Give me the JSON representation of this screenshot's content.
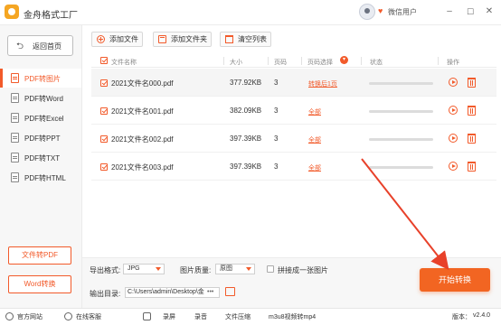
{
  "app": {
    "title": "金舟格式工厂",
    "username": "微信用户",
    "window_buttons": [
      "minimize-icon",
      "maximize-icon",
      "close-icon"
    ]
  },
  "sidebar": {
    "home_label": "返回首页",
    "items": [
      {
        "label": "PDF转图片",
        "active": true
      },
      {
        "label": "PDF转Word",
        "active": false
      },
      {
        "label": "PDF转Excel",
        "active": false
      },
      {
        "label": "PDF转PPT",
        "active": false
      },
      {
        "label": "PDF转TXT",
        "active": false
      },
      {
        "label": "PDF转HTML",
        "active": false
      }
    ],
    "bottom_buttons": [
      "文件转PDF",
      "Word转换"
    ]
  },
  "toolbar": {
    "add_file": "添加文件",
    "add_folder": "添加文件夹",
    "clear_list": "清空列表"
  },
  "table": {
    "headers": {
      "name": "文件名称",
      "size": "大小",
      "pages": "页码",
      "page_select": "页码选择",
      "status": "状态",
      "actions": "操作"
    },
    "rows": [
      {
        "name": "2021文件名000.pdf",
        "size": "377.92KB",
        "pages": "3",
        "page_select": "转换后1页",
        "progress": 0,
        "highlighted": true
      },
      {
        "name": "2021文件名001.pdf",
        "size": "382.09KB",
        "pages": "3",
        "page_select": "全部",
        "progress": 0,
        "highlighted": false
      },
      {
        "name": "2021文件名002.pdf",
        "size": "397.39KB",
        "pages": "3",
        "page_select": "全部",
        "progress": 0,
        "highlighted": false
      },
      {
        "name": "2021文件名003.pdf",
        "size": "397.39KB",
        "pages": "3",
        "page_select": "全部",
        "progress": 0,
        "highlighted": false
      }
    ]
  },
  "options": {
    "format_label": "导出格式:",
    "format_value": "JPG",
    "quality_label": "图片质量:",
    "quality_value": "原图",
    "merge_label": "拼接成一张图片",
    "output_label": "输出目录:",
    "output_path": "C:\\Users\\admin\\Desktop\\金",
    "more": "•••"
  },
  "start_button": "开始转换",
  "statusbar": {
    "website": "官方网站",
    "service": "在线客服",
    "record": "录屏",
    "audio": "录音",
    "compress": "文件压缩",
    "video": "m3u8视频转mp4",
    "version_label": "版本：",
    "version": "v2.4.0"
  },
  "colors": {
    "accent": "#f25a2a",
    "start_button": "#f26522"
  }
}
